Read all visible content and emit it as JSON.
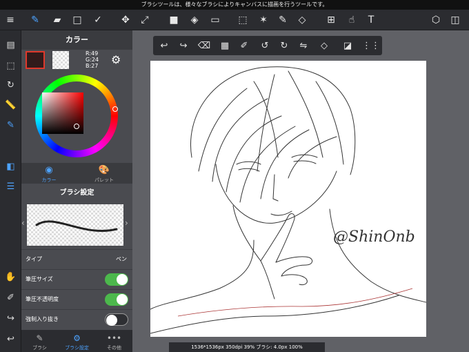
{
  "status_bar": {
    "text": "ブラシツールは、様々なブラシによりキャンバスに描画を行うツールです。"
  },
  "top_toolbar": {
    "items": [
      {
        "name": "menu",
        "glyph": "≡"
      },
      {
        "name": "brush",
        "glyph": "✎"
      },
      {
        "name": "eraser",
        "glyph": "▰"
      },
      {
        "name": "shape",
        "glyph": "□"
      },
      {
        "name": "snap",
        "glyph": "✓"
      },
      {
        "name": "move",
        "glyph": "✥"
      },
      {
        "name": "transform",
        "glyph": "⤢"
      },
      {
        "name": "fill-color",
        "glyph": "■"
      },
      {
        "name": "bucket",
        "glyph": "◈"
      },
      {
        "name": "gradient",
        "glyph": "▭"
      },
      {
        "name": "select",
        "glyph": "⬚"
      },
      {
        "name": "magic-wand",
        "glyph": "✶"
      },
      {
        "name": "select-pen",
        "glyph": "✎"
      },
      {
        "name": "select-eraser",
        "glyph": "◇"
      },
      {
        "name": "frame",
        "glyph": "⊞"
      },
      {
        "name": "hand-select",
        "glyph": "☝"
      },
      {
        "name": "text",
        "glyph": "T"
      },
      {
        "name": "material",
        "glyph": "⬡"
      },
      {
        "name": "layers",
        "glyph": "◫"
      }
    ]
  },
  "left_strip": {
    "items": [
      {
        "name": "pages",
        "glyph": "▤"
      },
      {
        "name": "selection",
        "glyph": "⬚"
      },
      {
        "name": "rotate",
        "glyph": "↻"
      },
      {
        "name": "ruler",
        "glyph": "📏"
      },
      {
        "name": "brush",
        "glyph": "✎"
      },
      {
        "name": "color-panel",
        "glyph": "◧"
      },
      {
        "name": "brush-list",
        "glyph": "☰"
      },
      {
        "name": "hand",
        "glyph": "✋"
      },
      {
        "name": "eyedropper",
        "glyph": "✐"
      },
      {
        "name": "redo",
        "glyph": "↪"
      },
      {
        "name": "undo",
        "glyph": "↩"
      }
    ]
  },
  "color_panel": {
    "title": "カラー",
    "rgb": {
      "r": "R:49",
      "g": "G:24",
      "b": "B:27"
    },
    "current_color": "#311b1b",
    "subtabs": [
      {
        "label": "カラー",
        "glyph": "◉"
      },
      {
        "label": "パレット",
        "glyph": "🎨"
      }
    ]
  },
  "brush_settings": {
    "title": "ブラシ設定",
    "rows": [
      {
        "label": "タイプ",
        "value": "ペン"
      },
      {
        "label": "筆圧サイズ",
        "toggle": "on"
      },
      {
        "label": "筆圧不透明度",
        "toggle": "on"
      },
      {
        "label": "強制入り抜き",
        "toggle": "off"
      }
    ]
  },
  "bottom_tabs": [
    {
      "label": "ブラシ",
      "glyph": "✎"
    },
    {
      "label": "ブラシ設定",
      "glyph": "⚙"
    },
    {
      "label": "その他",
      "glyph": "•••"
    }
  ],
  "canvas_toolbar": {
    "items": [
      {
        "name": "undo",
        "glyph": "↩"
      },
      {
        "name": "redo",
        "glyph": "↪"
      },
      {
        "name": "clear",
        "glyph": "⌫"
      },
      {
        "name": "transparent",
        "glyph": "▦"
      },
      {
        "name": "eyedropper",
        "glyph": "✐"
      },
      {
        "name": "rotate-left",
        "glyph": "↺"
      },
      {
        "name": "rotate-right",
        "glyph": "↻"
      },
      {
        "name": "flip",
        "glyph": "⇋"
      },
      {
        "name": "snap-off",
        "glyph": "◇"
      },
      {
        "name": "fullscreen",
        "glyph": "◪"
      },
      {
        "name": "more",
        "glyph": "⋮⋮"
      }
    ]
  },
  "canvas": {
    "signature": "@ShinOnb"
  },
  "footer": {
    "info": "1536*1536px 350dpi 39% ブラシ: 4.0px 100%"
  }
}
